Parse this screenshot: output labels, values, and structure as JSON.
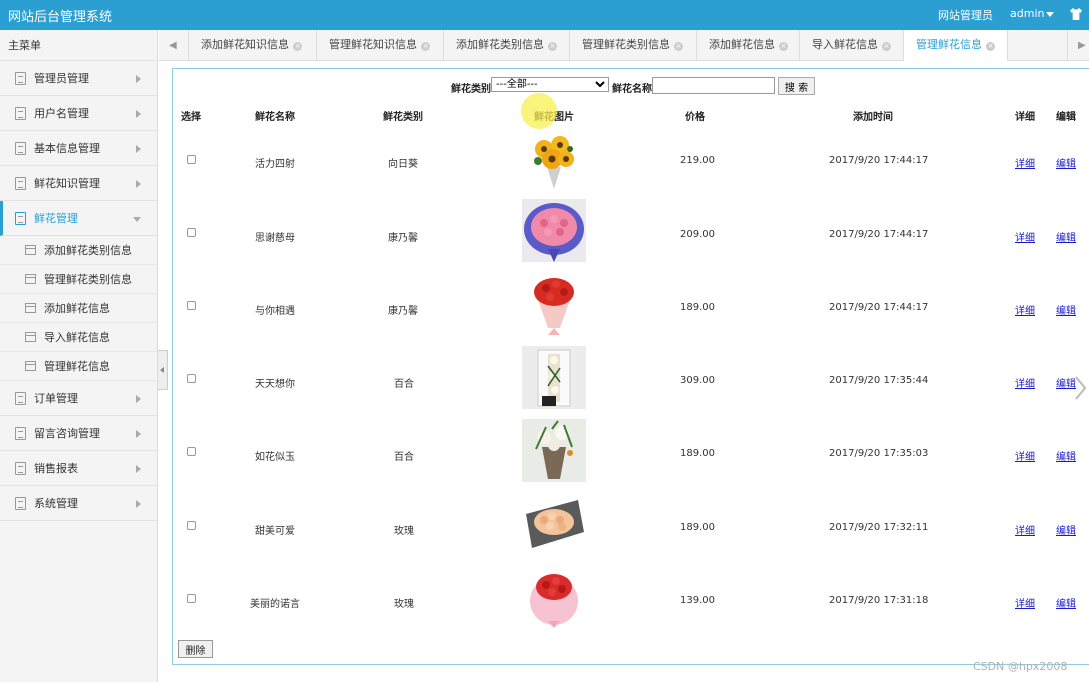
{
  "app": {
    "title": "网站后台管理系统",
    "role": "网站管理员",
    "user": "admin"
  },
  "sidebar": {
    "header": "主菜单",
    "items": [
      {
        "label": "管理员管理"
      },
      {
        "label": "用户名管理"
      },
      {
        "label": "基本信息管理"
      },
      {
        "label": "鲜花知识管理"
      },
      {
        "label": "鲜花管理",
        "active": true
      },
      {
        "label": "订单管理"
      },
      {
        "label": "留言咨询管理"
      },
      {
        "label": "销售报表"
      },
      {
        "label": "系统管理"
      }
    ],
    "subitems": [
      {
        "label": "添加鲜花类别信息"
      },
      {
        "label": "管理鲜花类别信息"
      },
      {
        "label": "添加鲜花信息"
      },
      {
        "label": "导入鲜花信息"
      },
      {
        "label": "管理鲜花信息"
      }
    ]
  },
  "tabs": [
    {
      "label": "添加鲜花知识信息"
    },
    {
      "label": "管理鲜花知识信息"
    },
    {
      "label": "添加鲜花类别信息"
    },
    {
      "label": "管理鲜花类别信息"
    },
    {
      "label": "添加鲜花信息"
    },
    {
      "label": "导入鲜花信息"
    },
    {
      "label": "管理鲜花信息",
      "active": true
    }
  ],
  "search": {
    "category_label": "鲜花类别",
    "category_value": "---全部---",
    "name_label": "鲜花名称:",
    "name_value": "",
    "button": "搜 索"
  },
  "table": {
    "headers": [
      "选择",
      "鲜花名称",
      "鲜花类别",
      "鲜花图片",
      "价格",
      "添加时间",
      "详细",
      "编辑"
    ],
    "rows": [
      {
        "name": "活力四射",
        "category": "向日葵",
        "price": "219.00",
        "time": "2017/9/20 17:44:17",
        "detail": "详细",
        "edit": "编辑",
        "image": "sunflower-bouquet"
      },
      {
        "name": "思谢慈母",
        "category": "康乃馨",
        "price": "209.00",
        "time": "2017/9/20 17:44:17",
        "detail": "详细",
        "edit": "编辑",
        "image": "pink-carnation-bouquet"
      },
      {
        "name": "与你相遇",
        "category": "康乃馨",
        "price": "189.00",
        "time": "2017/9/20 17:44:17",
        "detail": "详细",
        "edit": "编辑",
        "image": "red-carnation-bouquet"
      },
      {
        "name": "天天想你",
        "category": "百合",
        "price": "309.00",
        "time": "2017/9/20 17:35:44",
        "detail": "详细",
        "edit": "编辑",
        "image": "lily-gift-box"
      },
      {
        "name": "如花似玉",
        "category": "百合",
        "price": "189.00",
        "time": "2017/9/20 17:35:03",
        "detail": "详细",
        "edit": "编辑",
        "image": "lily-bouquet"
      },
      {
        "name": "甜美可爱",
        "category": "玫瑰",
        "price": "189.00",
        "time": "2017/9/20 17:32:11",
        "detail": "详细",
        "edit": "编辑",
        "image": "champagne-rose-box"
      },
      {
        "name": "美丽的诺言",
        "category": "玫瑰",
        "price": "139.00",
        "time": "2017/9/20 17:31:18",
        "detail": "详细",
        "edit": "编辑",
        "image": "red-rose-bouquet"
      }
    ]
  },
  "delete_button": "删除",
  "watermark": "CSDN @hpx2008",
  "colors": {
    "accent": "#2b9fd2",
    "link": "#1a1acc"
  }
}
